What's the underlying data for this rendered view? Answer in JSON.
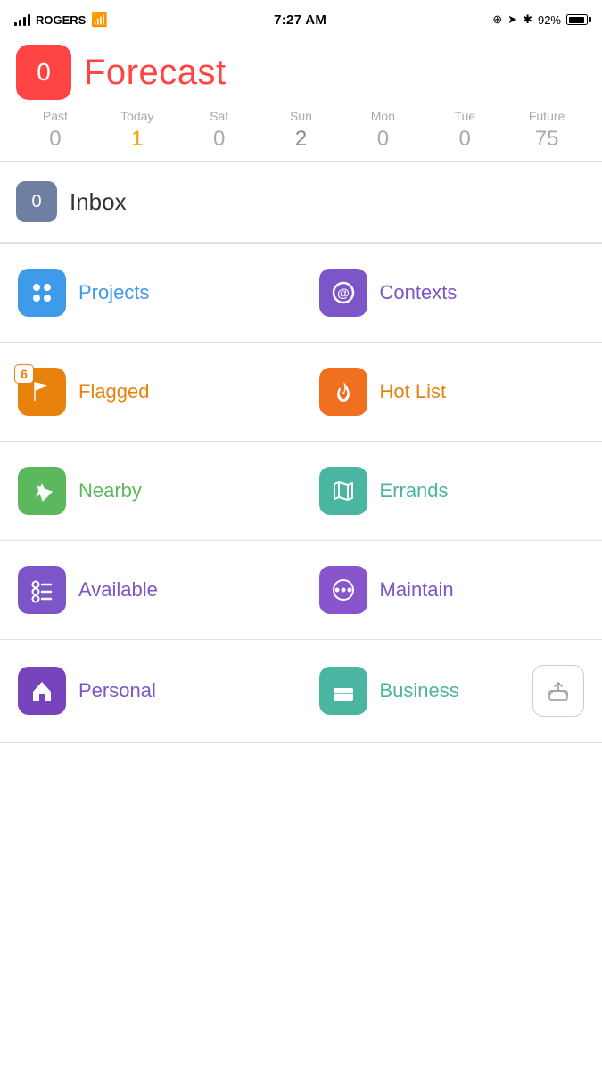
{
  "statusBar": {
    "carrier": "ROGERS",
    "time": "7:27 AM",
    "battery": "92%"
  },
  "header": {
    "badge": "0",
    "title": "Forecast"
  },
  "days": [
    {
      "label": "Past",
      "count": "0",
      "style": "normal"
    },
    {
      "label": "Today",
      "count": "1",
      "style": "today"
    },
    {
      "label": "Sat",
      "count": "0",
      "style": "normal"
    },
    {
      "label": "Sun",
      "count": "2",
      "style": "has-items"
    },
    {
      "label": "Mon",
      "count": "0",
      "style": "normal"
    },
    {
      "label": "Tue",
      "count": "0",
      "style": "normal"
    },
    {
      "label": "Future",
      "count": "75",
      "style": "future"
    }
  ],
  "inbox": {
    "badge": "0",
    "label": "Inbox"
  },
  "grid": [
    {
      "id": "projects",
      "label": "Projects",
      "iconColor": "icon-blue",
      "labelColor": "label-blue",
      "iconType": "projects"
    },
    {
      "id": "contexts",
      "label": "Contexts",
      "iconColor": "icon-purple",
      "labelColor": "label-purple",
      "iconType": "contexts"
    },
    {
      "id": "flagged",
      "label": "Flagged",
      "iconColor": "icon-orange",
      "labelColor": "label-orange",
      "iconType": "flagged",
      "badge": "6"
    },
    {
      "id": "hotlist",
      "label": "Hot List",
      "iconColor": "icon-orange2",
      "labelColor": "label-orange",
      "iconType": "hotlist"
    },
    {
      "id": "nearby",
      "label": "Nearby",
      "iconColor": "icon-green",
      "labelColor": "label-green",
      "iconType": "nearby"
    },
    {
      "id": "errands",
      "label": "Errands",
      "iconColor": "icon-teal",
      "labelColor": "label-teal",
      "iconType": "errands"
    },
    {
      "id": "available",
      "label": "Available",
      "iconColor": "icon-purple2",
      "labelColor": "label-purple",
      "iconType": "available"
    },
    {
      "id": "maintain",
      "label": "Maintain",
      "iconColor": "icon-purple3",
      "labelColor": "label-purple",
      "iconType": "maintain"
    },
    {
      "id": "personal",
      "label": "Personal",
      "iconColor": "icon-purple4",
      "labelColor": "label-purple",
      "iconType": "personal"
    },
    {
      "id": "business",
      "label": "Business",
      "iconColor": "icon-teal",
      "labelColor": "label-teal",
      "iconType": "business"
    }
  ],
  "addButton": {
    "label": "Add"
  }
}
